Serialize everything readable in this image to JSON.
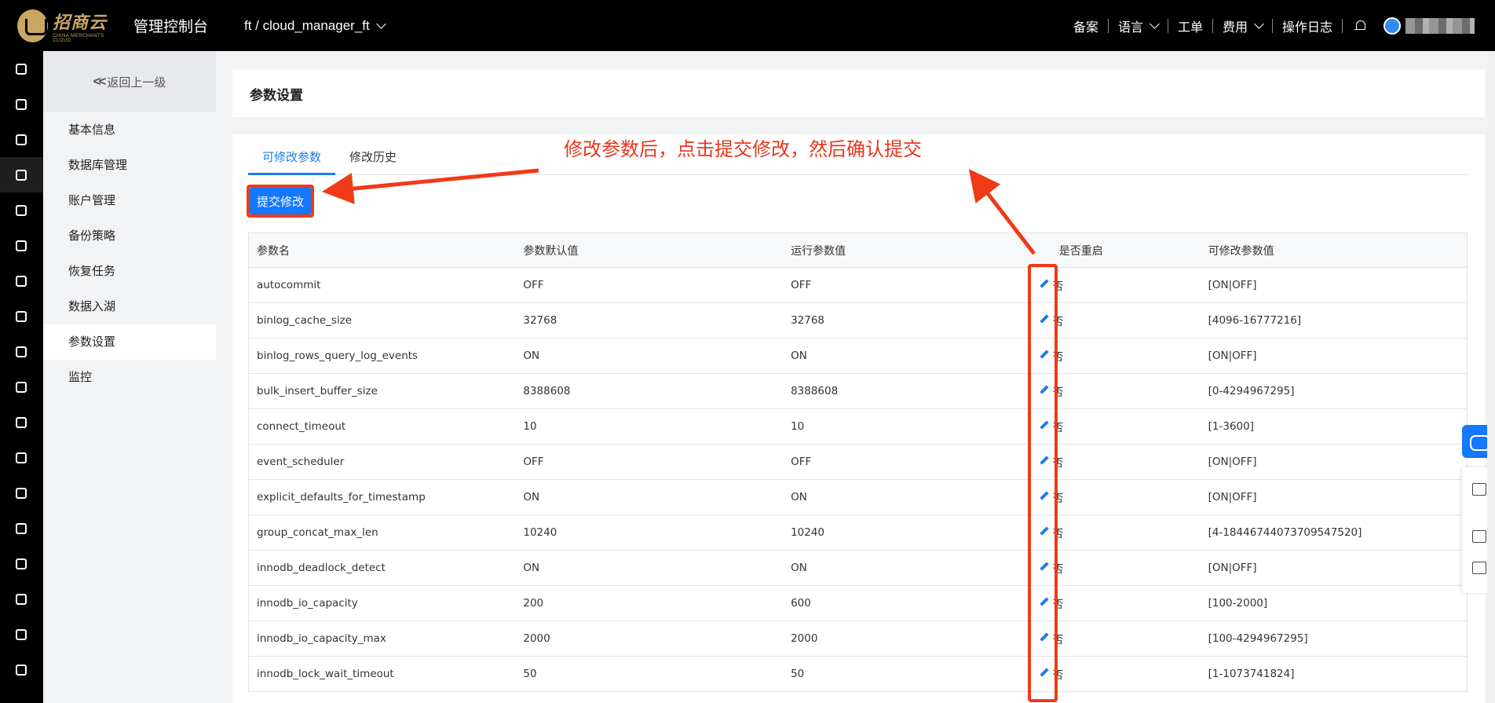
{
  "header": {
    "logo_cn": "招商云",
    "logo_en": "CHINA MERCHANTS CLOUD",
    "app_title": "管理控制台",
    "project": "ft / cloud_manager_ft",
    "nav": [
      "备案",
      "语言",
      "工单",
      "费用",
      "操作日志"
    ]
  },
  "sidebar": {
    "back_label": "返回上一级",
    "items": [
      "基本信息",
      "数据库管理",
      "账户管理",
      "备份策略",
      "恢复任务",
      "数据入湖",
      "参数设置",
      "监控"
    ],
    "active": "参数设置"
  },
  "page": {
    "title": "参数设置",
    "tabs": [
      "可修改参数",
      "修改历史"
    ],
    "active_tab": "可修改参数",
    "submit_label": "提交修改"
  },
  "table": {
    "headers": [
      "参数名",
      "参数默认值",
      "运行参数值",
      "",
      "是否重启",
      "可修改参数值"
    ],
    "rows": [
      [
        "autocommit",
        "OFF",
        "OFF",
        "否",
        "[ON|OFF]"
      ],
      [
        "binlog_cache_size",
        "32768",
        "32768",
        "否",
        "[4096-16777216]"
      ],
      [
        "binlog_rows_query_log_events",
        "ON",
        "ON",
        "否",
        "[ON|OFF]"
      ],
      [
        "bulk_insert_buffer_size",
        "8388608",
        "8388608",
        "否",
        "[0-4294967295]"
      ],
      [
        "connect_timeout",
        "10",
        "10",
        "否",
        "[1-3600]"
      ],
      [
        "event_scheduler",
        "OFF",
        "OFF",
        "否",
        "[ON|OFF]"
      ],
      [
        "explicit_defaults_for_timestamp",
        "ON",
        "ON",
        "否",
        "[ON|OFF]"
      ],
      [
        "group_concat_max_len",
        "10240",
        "10240",
        "否",
        "[4-18446744073709547520]"
      ],
      [
        "innodb_deadlock_detect",
        "ON",
        "ON",
        "否",
        "[ON|OFF]"
      ],
      [
        "innodb_io_capacity",
        "200",
        "600",
        "否",
        "[100-2000]"
      ],
      [
        "innodb_io_capacity_max",
        "2000",
        "2000",
        "否",
        "[100-4294967295]"
      ],
      [
        "innodb_lock_wait_timeout",
        "50",
        "50",
        "否",
        "[1-1073741824]"
      ]
    ]
  },
  "annotation": {
    "text": "修改参数后，点击提交修改，然后确认提交",
    "color": "#e8351a"
  },
  "colors": {
    "accent": "#1677ff",
    "annotation_red": "#f03a17"
  }
}
